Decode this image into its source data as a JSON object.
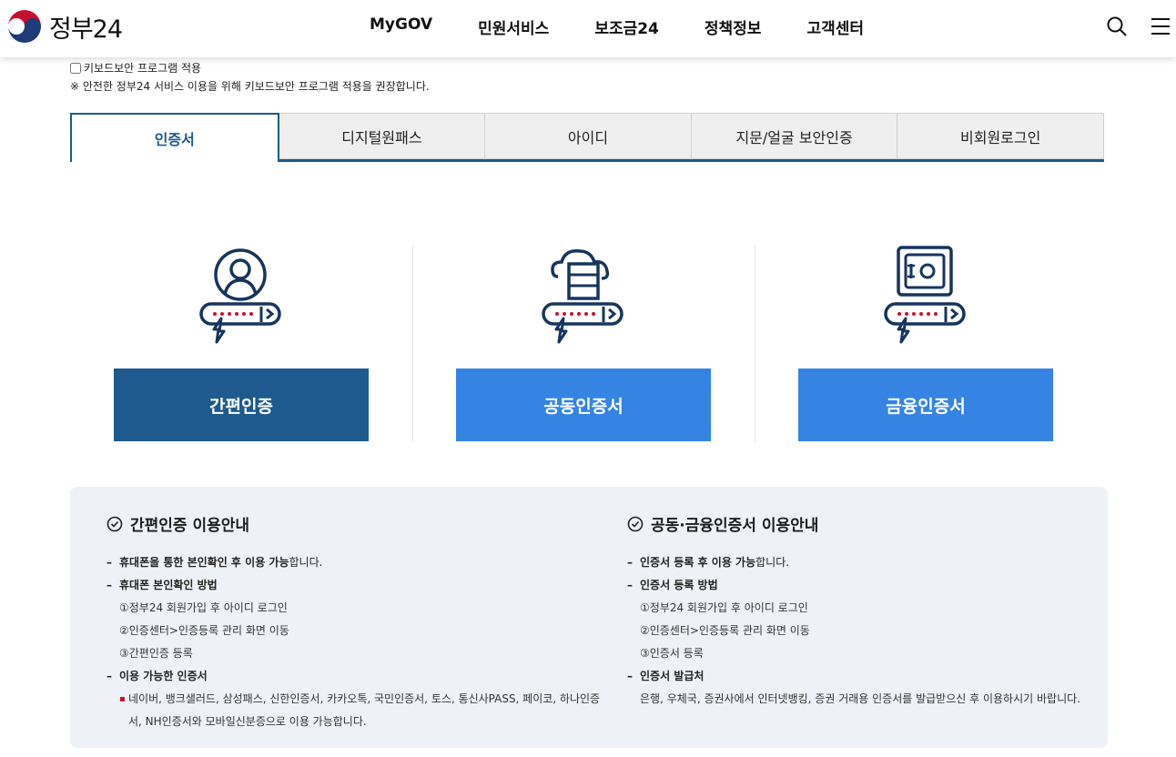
{
  "header": {
    "logo_text": "정부24",
    "nav": [
      "MyGOV",
      "민원서비스",
      "보조금24",
      "정책정보",
      "고객센터"
    ],
    "search_icon": "search-icon",
    "menu_icon": "hamburger-menu-icon"
  },
  "keyboard": {
    "checkbox_label": "키보드보안 프로그램 적용",
    "note": "※ 안전한 정부24 서비스 이용을 위해 키보드보안 프로그램 적용을 권장합니다."
  },
  "tabs": [
    "인증서",
    "디지털원패스",
    "아이디",
    "지문/얼굴 보안인증",
    "비회원로그인"
  ],
  "active_tab": "인증서",
  "cards": [
    {
      "label": "간편인증",
      "icon": "user-login-icon",
      "color": "#1e5a8e"
    },
    {
      "label": "공동인증서",
      "icon": "cloud-server-login-icon",
      "color": "#3584e4"
    },
    {
      "label": "금융인증서",
      "icon": "safe-login-icon",
      "color": "#3584e4"
    }
  ],
  "guide_left": {
    "title": "간편인증 이용안내",
    "item1_bold": "휴대폰을 통한 본인확인 후 이용 가능",
    "item1_rest": "합니다.",
    "item2_bold": "휴대폰 본인확인 방법",
    "steps": [
      "①정부24 회원가입 후 아이디 로그인",
      "②인증센터>인증등록 관리 화면 이동",
      "③간편인증 등록"
    ],
    "item3_bold": "이용 가능한 인증서",
    "item3_detail": "네이버, 뱅크샐러드, 삼성패스, 신한인증서, 카카오톡, 국민인증서, 토스, 통신사PASS, 페이코, 하나인증서, NH인증서와 모바일신분증으로 이용 가능합니다."
  },
  "guide_right": {
    "title": "공동·금융인증서 이용안내",
    "item1_bold": "인증서 등록 후 이용 가능",
    "item1_rest": "합니다.",
    "item2_bold": "인증서 등록 방법",
    "steps": [
      "①정부24 회원가입 후 아이디 로그인",
      "②인증센터>인증등록 관리 화면 이동",
      "③인증서 등록"
    ],
    "item3_bold": "인증서 발급처",
    "item3_detail": "은행, 우체국, 증권사에서 인터넷뱅킹, 증권 거래용 인증서를 발급받으신 후 이용하시기 바랍니다."
  },
  "colors": {
    "primary": "#1e5a8e",
    "accent": "#3584e4",
    "red": "#c8102e"
  }
}
